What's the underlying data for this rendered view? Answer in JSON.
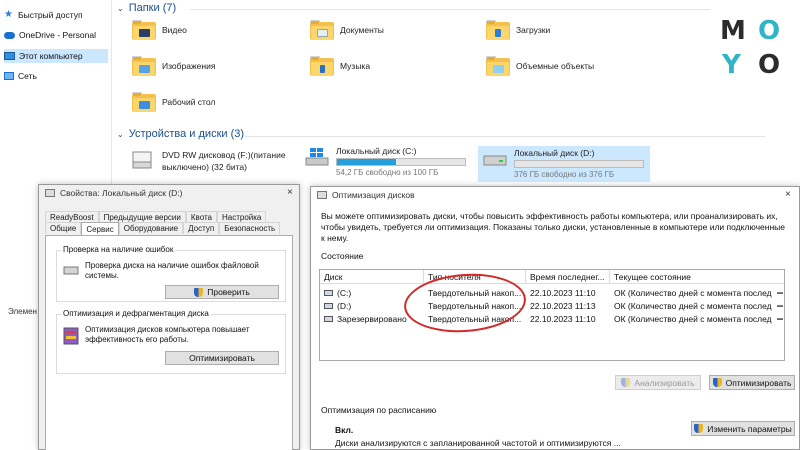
{
  "explorer": {
    "nav": {
      "items": [
        {
          "label": "Быстрый доступ",
          "icon": "star-icon"
        },
        {
          "label": "OneDrive - Personal",
          "icon": "cloud-icon"
        },
        {
          "label": "Этот компьютер",
          "icon": "computer-icon"
        },
        {
          "label": "Сеть",
          "icon": "network-icon"
        }
      ],
      "footer": "Элемен"
    },
    "folders_header": "Папки (7)",
    "folders": [
      {
        "label": "Видео",
        "icon": "video-folder-icon"
      },
      {
        "label": "Документы",
        "icon": "documents-folder-icon"
      },
      {
        "label": "Загрузки",
        "icon": "downloads-folder-icon"
      },
      {
        "label": "Изображения",
        "icon": "pictures-folder-icon"
      },
      {
        "label": "Музыка",
        "icon": "music-folder-icon"
      },
      {
        "label": "Объемные объекты",
        "icon": "3d-objects-folder-icon"
      },
      {
        "label": "Рабочий стол",
        "icon": "desktop-folder-icon"
      }
    ],
    "devices_header": "Устройства и диски (3)",
    "devices": [
      {
        "name": "DVD RW дисковод (F:)(питание",
        "name2": "выключено) (32 бита)",
        "icon": "dvd-drive-icon"
      },
      {
        "name": "Локальный диск (C:)",
        "free": "54,2 ГБ свободно из 100 ГБ",
        "used_fraction": 0.46,
        "icon": "windows-drive-icon"
      },
      {
        "name": "Локальный диск (D:)",
        "free": "376 ГБ свободно из 376 ГБ",
        "used_fraction": 0.0,
        "icon": "drive-icon"
      }
    ]
  },
  "logo": {
    "letters": [
      "M",
      "O",
      "Y",
      "O"
    ],
    "accent": "#2fb5c8"
  },
  "properties": {
    "title": "Свойства: Локальный диск (D:)",
    "close": "×",
    "tabs_row1": [
      "ReadyBoost",
      "Предыдущие версии",
      "Квота",
      "Настройка"
    ],
    "tabs_row2": [
      "Общие",
      "Сервис",
      "Оборудование",
      "Доступ",
      "Безопасность"
    ],
    "active_tab": "Сервис",
    "check_group": {
      "title": "Проверка на наличие ошибок",
      "text": "Проверка диска на наличие ошибок файловой системы.",
      "button": "Проверить"
    },
    "optimize_group": {
      "title": "Оптимизация и дефрагментация диска",
      "text": "Оптимизация дисков компьютера повышает эффективность его работы.",
      "button": "Оптимизировать"
    }
  },
  "optimize": {
    "title": "Оптимизация дисков",
    "close": "×",
    "description": "Вы можете оптимизировать диски, чтобы повысить эффективность работы компьютера, или проанализировать их, чтобы увидеть, требуется ли оптимизация. Показаны только диски, установленные в компьютере или подключенные к нему.",
    "status_label": "Состояние",
    "columns": [
      "Диск",
      "Тип носителя",
      "Время последнег...",
      "Текущее состояние"
    ],
    "rows": [
      {
        "disk": "(C:)",
        "media": "Твердотельный накоп...",
        "time": "22.10.2023 11:10",
        "state": "ОК (Количество дней с момента послед"
      },
      {
        "disk": "(D:)",
        "media": "Твердотельный накоп...",
        "time": "22.10.2023 11:13",
        "state": "ОК (Количество дней с момента послед"
      },
      {
        "disk": "Зарезервировано",
        "media": "Твердотельный накоп...",
        "time": "22.10.2023 11:10",
        "state": "ОК (Количество дней с момента послед"
      }
    ],
    "analyze_button": "Анализировать",
    "optimize_button": "Оптимизировать",
    "schedule_label": "Оптимизация по расписанию",
    "schedule_state": "Вкл.",
    "schedule_text": "Диски анализируются с запланированной частотой и оптимизируются ...",
    "change_button": "Изменить параметры"
  },
  "colors": {
    "highlight_oval": "#d22a2a",
    "selection": "#cce8ff",
    "progress": "#26a0da"
  }
}
